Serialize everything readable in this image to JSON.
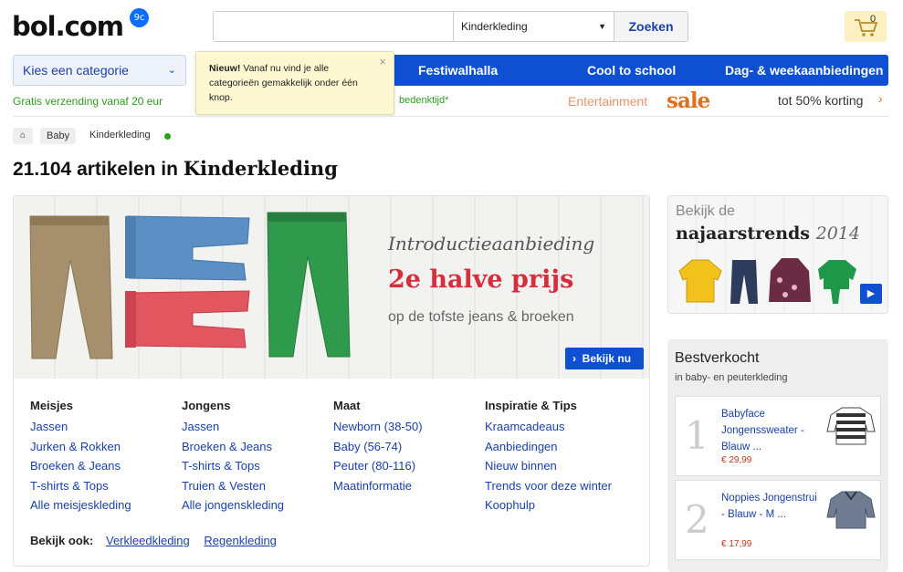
{
  "header": {
    "logo": "bol.com",
    "logo_badge": "9c",
    "search": {
      "value": "",
      "placeholder": ""
    },
    "category_value": "Kinderkleding",
    "search_button": "Zoeken",
    "cart_count": "0"
  },
  "nav": {
    "category_select": "Kies een categorie",
    "items": [
      "Festiwalhalla",
      "Cool to school",
      "Dag- & weekaanbiedingen"
    ]
  },
  "tooltip": {
    "bold": "Nieuw!",
    "text": " Vanaf nu vind je alle categorieën gemakkelijk onder één knop.",
    "close": "×"
  },
  "promo": {
    "left": "Gratis verzending vanaf 20 eur",
    "mid": "bedenktijd*",
    "entertainment": "Entertainment",
    "sale": "sale",
    "discount": "tot 50% korting",
    "arrow": "›"
  },
  "breadcrumb": {
    "home": "⌂",
    "baby": "Baby",
    "current": "Kinderkleding"
  },
  "title": {
    "count": "21.104 artikelen in ",
    "category": "Kinderkleding"
  },
  "banner": {
    "intro": "Introductieaanbieding",
    "main": "2e halve prijs",
    "sub": "op de tofste jeans & broeken",
    "button": "Bekijk nu"
  },
  "columns": [
    {
      "title": "Meisjes",
      "links": [
        "Jassen",
        "Jurken & Rokken",
        "Broeken & Jeans",
        "T-shirts & Tops",
        "Alle meisjeskleding"
      ]
    },
    {
      "title": "Jongens",
      "links": [
        "Jassen",
        "Broeken & Jeans",
        "T-shirts & Tops",
        "Truien & Vesten",
        "Alle jongenskleding"
      ]
    },
    {
      "title": "Maat",
      "links": [
        "Newborn (38-50)",
        "Baby (56-74)",
        "Peuter (80-116)",
        "Maatinformatie"
      ]
    },
    {
      "title": "Inspiratie & Tips",
      "links": [
        "Kraamcadeaus",
        "Aanbiedingen",
        "Nieuw binnen",
        "Trends voor deze winter",
        "Koophulp"
      ]
    }
  ],
  "see_also": {
    "label": "Bekijk ook:",
    "links": [
      "Verkleedkleding",
      "Regenkleding"
    ]
  },
  "trends": {
    "line1": "Bekijk de",
    "line2": "najaarstrends",
    "year": "2014"
  },
  "bestsellers": {
    "title": "Bestverkocht",
    "subtitle": "in baby- en peuterkleding",
    "items": [
      {
        "rank": "1",
        "name": "Babyface Jongenssweater - Blauw ...",
        "price": "€ 29,99"
      },
      {
        "rank": "2",
        "name": "Noppies Jongenstrui - Blauw - M ...",
        "price": "€ 17,99"
      }
    ]
  },
  "colors": {
    "brand_blue": "#0f4fd1",
    "link_blue": "#1a3fa8",
    "promo_green": "#2e9c1f",
    "price_red": "#c8331f",
    "banner_red": "#d62e3d"
  }
}
